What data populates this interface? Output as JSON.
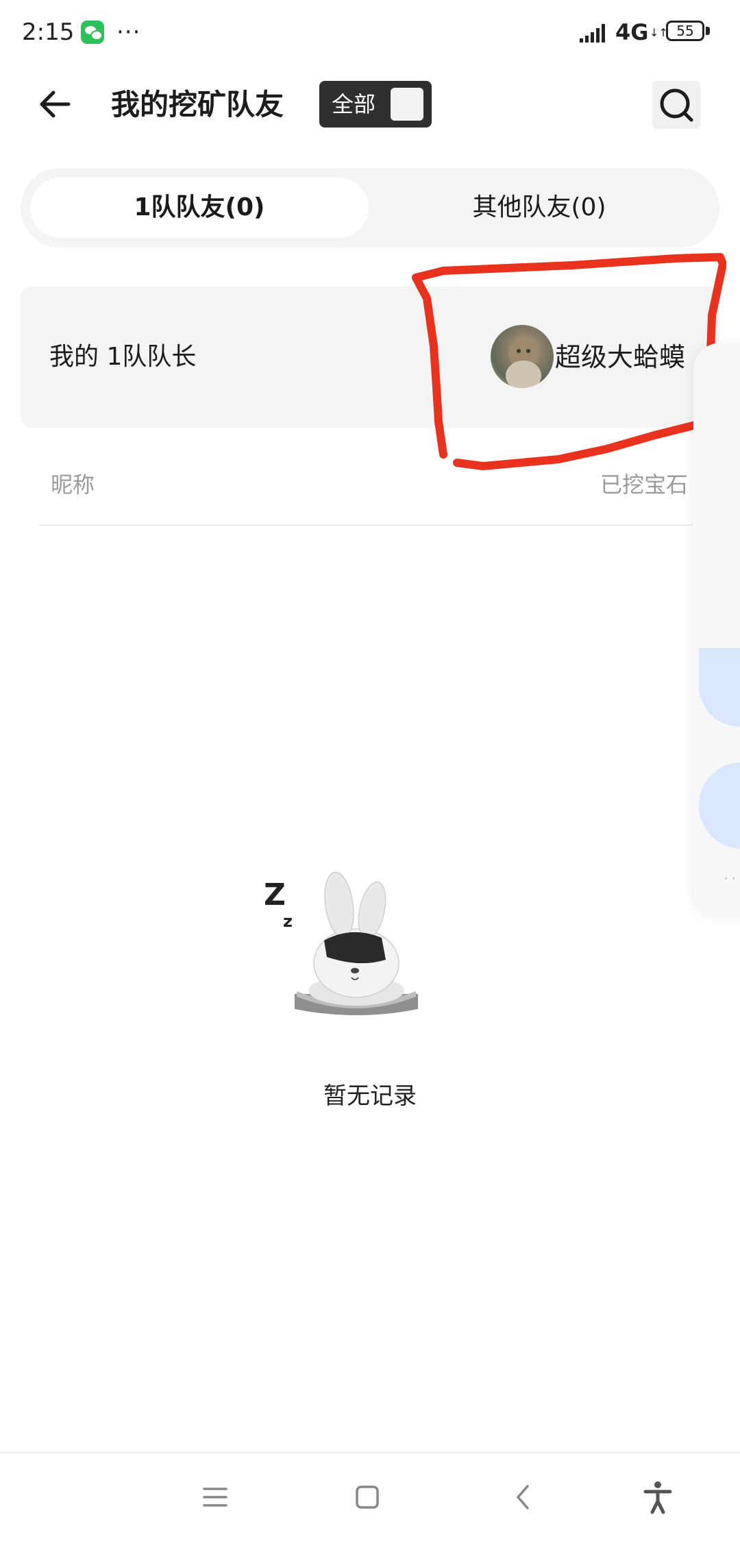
{
  "status_bar": {
    "time": "2:15",
    "app_notification_icon": "wechat-icon",
    "more": "···",
    "network": "4G",
    "network_arrows": "↓↑",
    "battery": "55"
  },
  "header": {
    "title": "我的挖矿队友",
    "filter_label": "全部",
    "back_icon": "arrow-left-icon",
    "search_icon": "search-icon"
  },
  "tabs": [
    {
      "label": "1队队友(0)",
      "active": true
    },
    {
      "label": "其他队友(0)",
      "active": false
    }
  ],
  "captain": {
    "label": "我的 1队队长",
    "name": "超级大蛤蟆"
  },
  "list_header": {
    "nickname": "昵称",
    "gems": "已挖宝石"
  },
  "empty_state": {
    "text": "暂无记录",
    "illustration": "sleeping-rabbit-illustration"
  },
  "bottom_nav": {
    "menu_icon": "menu-icon",
    "home_icon": "home-square-icon",
    "back_icon": "back-chevron-icon",
    "accessibility_icon": "accessibility-icon"
  },
  "colors": {
    "annotation": "#e8321e",
    "filter_pill": "#2f2f2f",
    "tab_track": "#f4f4f4",
    "side_bubble": "#d9e6fb"
  }
}
